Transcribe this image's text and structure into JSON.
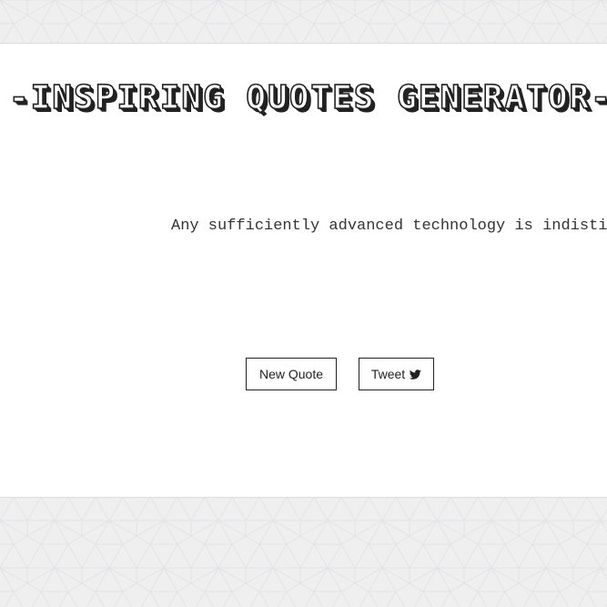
{
  "header": {
    "title": "-INSPIRING QUOTES GENERATOR-"
  },
  "quote": {
    "text": "Any sufficiently advanced technology is indistinguishable from magic."
  },
  "actions": {
    "new_quote_label": "New Quote",
    "tweet_label": "Tweet"
  },
  "icons": {
    "tweet": "twitter-bird-icon"
  },
  "colors": {
    "page_background": "#efeff0",
    "pattern_line": "#e4e4e6",
    "card_background": "#ffffff",
    "text": "#222222",
    "button_border": "#222222"
  }
}
